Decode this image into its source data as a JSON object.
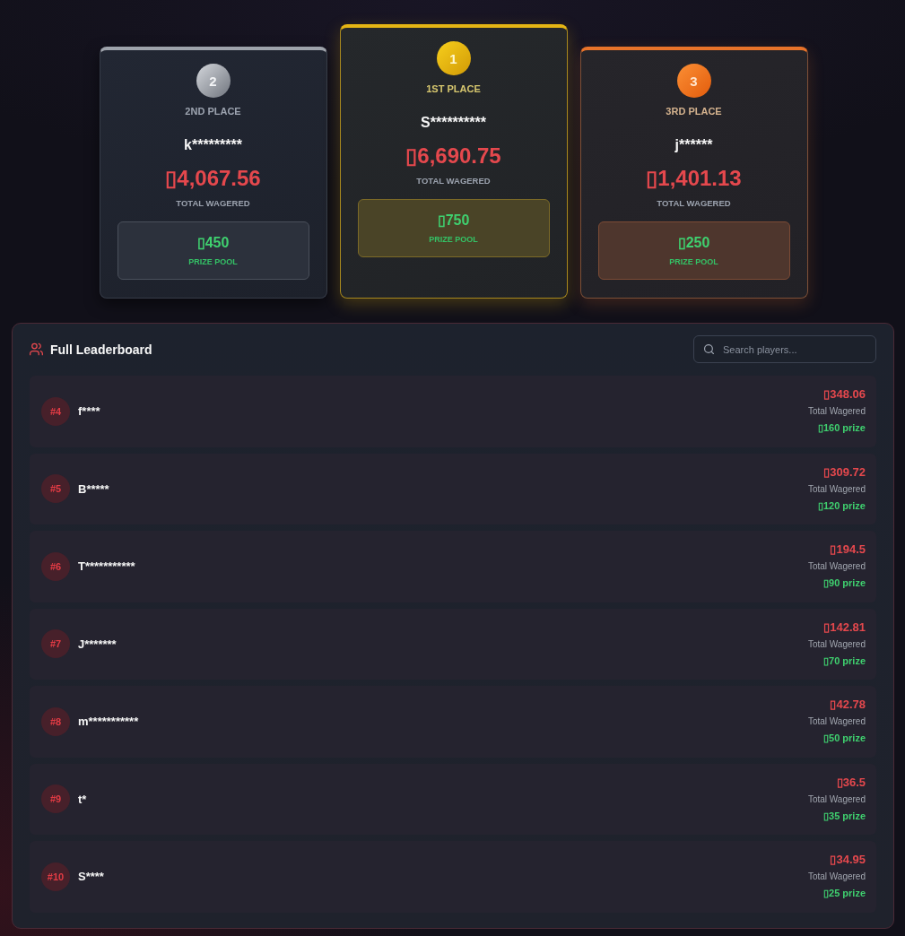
{
  "podium": [
    {
      "kind": "silver",
      "rank": "2",
      "place": "2ND PLACE",
      "name": "k*********",
      "wagered": "▯4,067.56",
      "wagered_label": "TOTAL WAGERED",
      "prize": "▯450",
      "prize_label": "PRIZE POOL"
    },
    {
      "kind": "gold",
      "rank": "1",
      "place": "1ST PLACE",
      "name": "S**********",
      "wagered": "▯6,690.75",
      "wagered_label": "TOTAL WAGERED",
      "prize": "▯750",
      "prize_label": "PRIZE POOL"
    },
    {
      "kind": "bronze",
      "rank": "3",
      "place": "3RD PLACE",
      "name": "j******",
      "wagered": "▯1,401.13",
      "wagered_label": "TOTAL WAGERED",
      "prize": "▯250",
      "prize_label": "PRIZE POOL"
    }
  ],
  "leaderboard": {
    "title": "Full Leaderboard",
    "search": {
      "placeholder": "Search players..."
    },
    "rows": [
      {
        "rank": "#4",
        "name": "f****",
        "wagered": "▯348.06",
        "wagered_label": "Total Wagered",
        "prize": "▯160 prize"
      },
      {
        "rank": "#5",
        "name": "B*****",
        "wagered": "▯309.72",
        "wagered_label": "Total Wagered",
        "prize": "▯120 prize"
      },
      {
        "rank": "#6",
        "name": "T***********",
        "wagered": "▯194.5",
        "wagered_label": "Total Wagered",
        "prize": "▯90 prize"
      },
      {
        "rank": "#7",
        "name": "J*******",
        "wagered": "▯142.81",
        "wagered_label": "Total Wagered",
        "prize": "▯70 prize"
      },
      {
        "rank": "#8",
        "name": "m***********",
        "wagered": "▯42.78",
        "wagered_label": "Total Wagered",
        "prize": "▯50 prize"
      },
      {
        "rank": "#9",
        "name": "t*",
        "wagered": "▯36.5",
        "wagered_label": "Total Wagered",
        "prize": "▯35 prize"
      },
      {
        "rank": "#10",
        "name": "S****",
        "wagered": "▯34.95",
        "wagered_label": "Total Wagered",
        "prize": "▯25 prize"
      }
    ]
  }
}
